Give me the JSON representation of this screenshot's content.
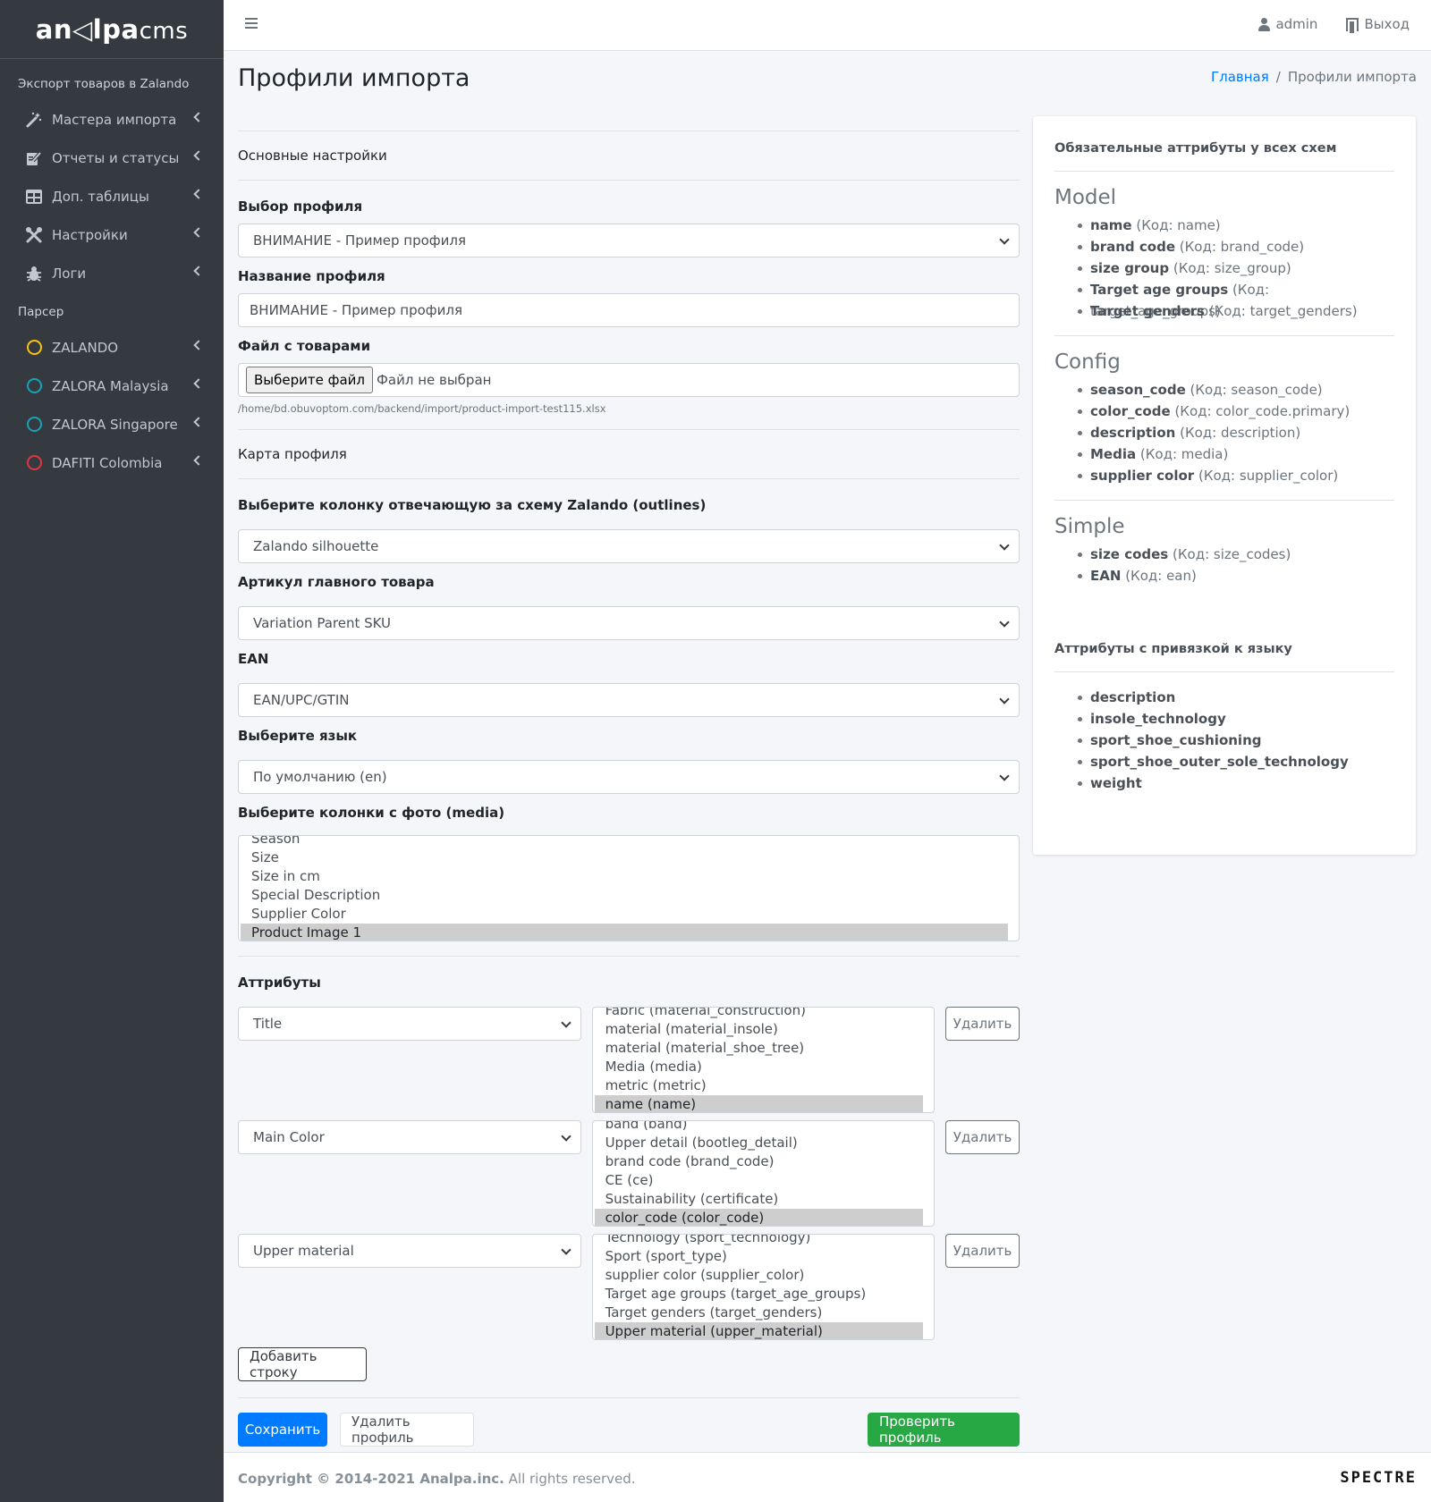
{
  "brand": {
    "logo_main": "an◁lpa",
    "logo_suffix": "cms"
  },
  "sidebar": {
    "section1": "Экспорт товаров в Zalando",
    "items1": [
      {
        "label": "Мастера импорта",
        "icon": "magic-wand-icon"
      },
      {
        "label": "Отчеты и статусы",
        "icon": "edit-document-icon"
      },
      {
        "label": "Доп. таблицы",
        "icon": "table-icon"
      },
      {
        "label": "Настройки",
        "icon": "tools-icon"
      },
      {
        "label": "Логи",
        "icon": "bug-icon"
      }
    ],
    "section2": "Парсер",
    "items2": [
      {
        "label": "ZALANDO",
        "color": "#ffc107"
      },
      {
        "label": "ZALORA Malaysia",
        "color": "#17a2b8"
      },
      {
        "label": "ZALORA Singapore",
        "color": "#17a2b8"
      },
      {
        "label": "DAFITI Colombia",
        "color": "#dc3545"
      }
    ]
  },
  "navbar": {
    "user": "admin",
    "logout": "Выход"
  },
  "header": {
    "title": "Профили импорта",
    "breadcrumb_home": "Главная",
    "breadcrumb_current": "Профили импорта"
  },
  "form": {
    "basic_settings": "Основные настройки",
    "profile_select_label": "Выбор профиля",
    "profile_select_value": "ВНИМАНИЕ - Пример профиля",
    "profile_name_label": "Название профиля",
    "profile_name_value": "ВНИМАНИЕ - Пример профиля",
    "file_label": "Файл с товарами",
    "file_button": "Выберите файл",
    "file_status": "Файл не выбран",
    "file_path": "/home/bd.obuvoptom.com/backend/import/product-import-test115.xlsx",
    "profile_map": "Карта профиля",
    "scheme_label": "Выберите колонку отвечающую за схему Zalando (outlines)",
    "scheme_value": "Zalando silhouette",
    "sku_label": "Артикул главного товара",
    "sku_value": "Variation Parent SKU",
    "ean_label": "EAN",
    "ean_value": "EAN/UPC/GTIN",
    "lang_label": "Выберите язык",
    "lang_value": "По умолчанию (en)",
    "media_label": "Выберите колонки с фото (media)",
    "media_options": [
      "Season",
      "Size",
      "Size in cm",
      "Special Description",
      "Supplier Color",
      "Product Image 1"
    ],
    "attributes_label": "Аттрибуты",
    "attribute_rows": [
      {
        "select": "Title",
        "options": [
          "Fabric (material_construction)",
          "material (material_insole)",
          "material (material_shoe_tree)",
          "Media (media)",
          "metric (metric)",
          "name (name)"
        ],
        "delete": "Удалить"
      },
      {
        "select": "Main Color",
        "options": [
          "band (band)",
          "Upper detail (bootleg_detail)",
          "brand code (brand_code)",
          "CE (ce)",
          "Sustainability (certificate)",
          "color_code (color_code)"
        ],
        "delete": "Удалить"
      },
      {
        "select": "Upper material",
        "options": [
          "Technology (sport_technology)",
          "Sport (sport_type)",
          "supplier color (supplier_color)",
          "Target age groups (target_age_groups)",
          "Target genders (target_genders)",
          "Upper material (upper_material)"
        ],
        "delete": "Удалить"
      }
    ],
    "add_row": "Добавить строку",
    "save": "Сохранить",
    "delete_profile": "Удалить профиль",
    "check_profile": "Проверить профиль"
  },
  "card": {
    "required_title": "Обязательные аттрибуты у всех схем",
    "groups": [
      {
        "name": "Model",
        "items": [
          {
            "name": "name",
            "code": "(Код: name)"
          },
          {
            "name": "brand code",
            "code": "(Код: brand_code)"
          },
          {
            "name": "size group",
            "code": "(Код: size_group)"
          },
          {
            "name": "Target age groups",
            "code": "(Код: target_age_groups)"
          },
          {
            "name": "Target genders",
            "code": "(Код: target_genders)"
          }
        ]
      },
      {
        "name": "Config",
        "items": [
          {
            "name": "season_code",
            "code": "(Код: season_code)"
          },
          {
            "name": "color_code",
            "code": "(Код: color_code.primary)"
          },
          {
            "name": "description",
            "code": "(Код: description)"
          },
          {
            "name": "Media",
            "code": "(Код: media)"
          },
          {
            "name": "supplier color",
            "code": "(Код: supplier_color)"
          }
        ]
      },
      {
        "name": "Simple",
        "items": [
          {
            "name": "size codes",
            "code": "(Код: size_codes)"
          },
          {
            "name": "EAN",
            "code": "(Код: ean)"
          }
        ]
      }
    ],
    "lang_title": "Аттрибуты с привязкой к языку",
    "lang_items": [
      "description",
      "insole_technology",
      "sport_shoe_cushioning",
      "sport_shoe_outer_sole_technology",
      "weight"
    ]
  },
  "footer": {
    "copyright_bold": "Copyright © 2014-2021 Analpa.inc.",
    "copyright_rest": " All rights reserved.",
    "logo": "SPECTRE"
  }
}
